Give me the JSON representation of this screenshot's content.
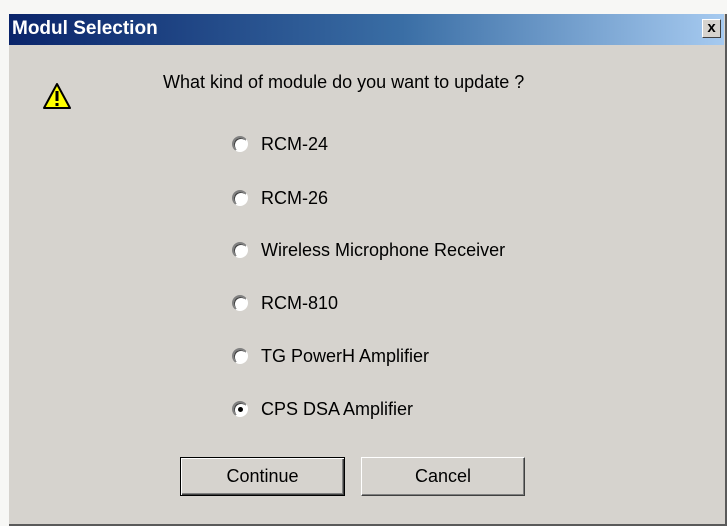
{
  "window": {
    "title": "Modul Selection",
    "close_glyph": "x"
  },
  "dialog": {
    "icon": "warning-icon",
    "question": "What kind of module do you want to update ?",
    "options": [
      {
        "label": "RCM-24",
        "checked": false
      },
      {
        "label": "RCM-26",
        "checked": false
      },
      {
        "label": "Wireless Microphone Receiver",
        "checked": false
      },
      {
        "label": "RCM-810",
        "checked": false
      },
      {
        "label": "TG PowerH Amplifier",
        "checked": false
      },
      {
        "label": "CPS DSA Amplifier",
        "checked": true
      }
    ],
    "continue_label": "Continue",
    "cancel_label": "Cancel"
  }
}
